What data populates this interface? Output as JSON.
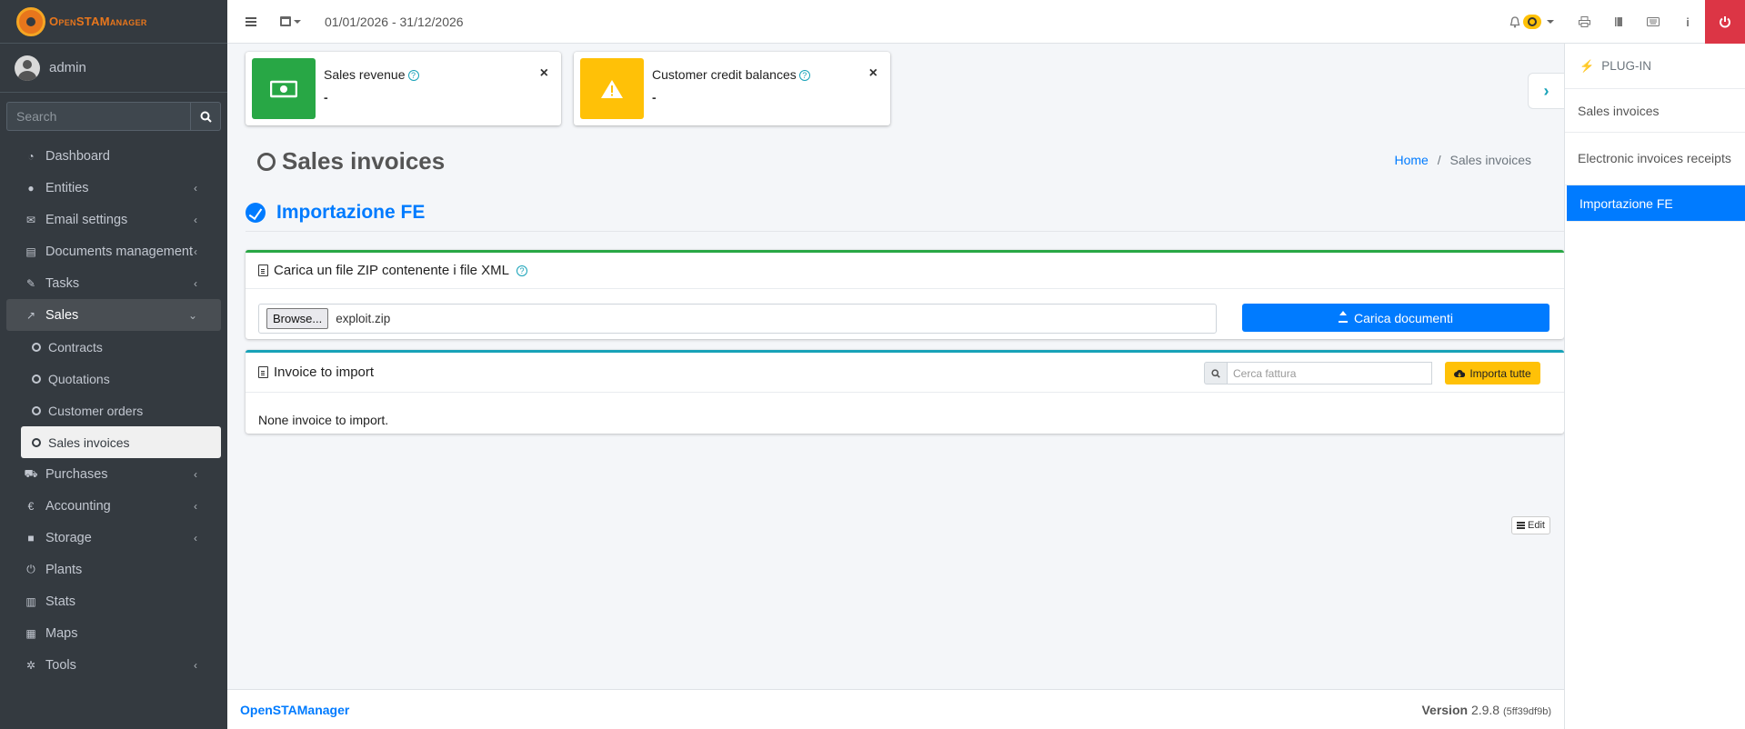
{
  "brand": {
    "name": "OpenSTAManager"
  },
  "user": {
    "name": "admin"
  },
  "sidebar": {
    "search_placeholder": "Search",
    "items": [
      {
        "label": "Dashboard",
        "icon": "dashboard-icon"
      },
      {
        "label": "Entities",
        "icon": "users-icon"
      },
      {
        "label": "Email settings",
        "icon": "envelope-icon"
      },
      {
        "label": "Documents management",
        "icon": "document-icon"
      },
      {
        "label": "Tasks",
        "icon": "wrench-icon"
      },
      {
        "label": "Sales",
        "icon": "chart-line-icon"
      },
      {
        "label": "Purchases",
        "icon": "cart-icon"
      },
      {
        "label": "Accounting",
        "icon": "euro-icon"
      },
      {
        "label": "Storage",
        "icon": "truck-icon"
      },
      {
        "label": "Plants",
        "icon": "plug-icon"
      },
      {
        "label": "Stats",
        "icon": "bar-chart-icon"
      },
      {
        "label": "Maps",
        "icon": "map-icon"
      },
      {
        "label": "Tools",
        "icon": "cog-icon"
      }
    ],
    "sales_sub": [
      "Contracts",
      "Quotations",
      "Customer orders",
      "Sales invoices"
    ]
  },
  "topbar": {
    "date_range": "01/01/2026 - 31/12/2026"
  },
  "info_boxes": [
    {
      "title": "Sales revenue",
      "value": "-",
      "color": "#28a745"
    },
    {
      "title": "Customer credit balances",
      "value": "-",
      "color": "#ffc107"
    }
  ],
  "page": {
    "title": "Sales invoices",
    "breadcrumb_home": "Home",
    "breadcrumb_sep": "/",
    "breadcrumb_current": "Sales invoices"
  },
  "plugin": {
    "title": "Importazione FE"
  },
  "upload_card": {
    "title": "Carica un file ZIP contenente i file XML",
    "browse_label": "Browse...",
    "file_name": "exploit.zip",
    "upload_button": "Carica documenti"
  },
  "import_card": {
    "title": "Invoice to import",
    "search_placeholder": "Cerca fattura",
    "import_all_button": "Importa tutte",
    "empty_text": "None invoice to import."
  },
  "edit_button": "Edit",
  "right_panel": {
    "header": "PLUG-IN",
    "items": [
      "Sales invoices",
      "Electronic invoices receipts",
      "Importazione FE"
    ]
  },
  "footer": {
    "brand": "OpenSTAManager",
    "version_label": "Version",
    "version": "2.9.8",
    "build": "(5ff39df9b)"
  },
  "colors": {
    "primary": "#007bff",
    "sidebar_bg": "#343a40",
    "danger": "#dc3545",
    "warning": "#ffc107",
    "success": "#28a745"
  }
}
